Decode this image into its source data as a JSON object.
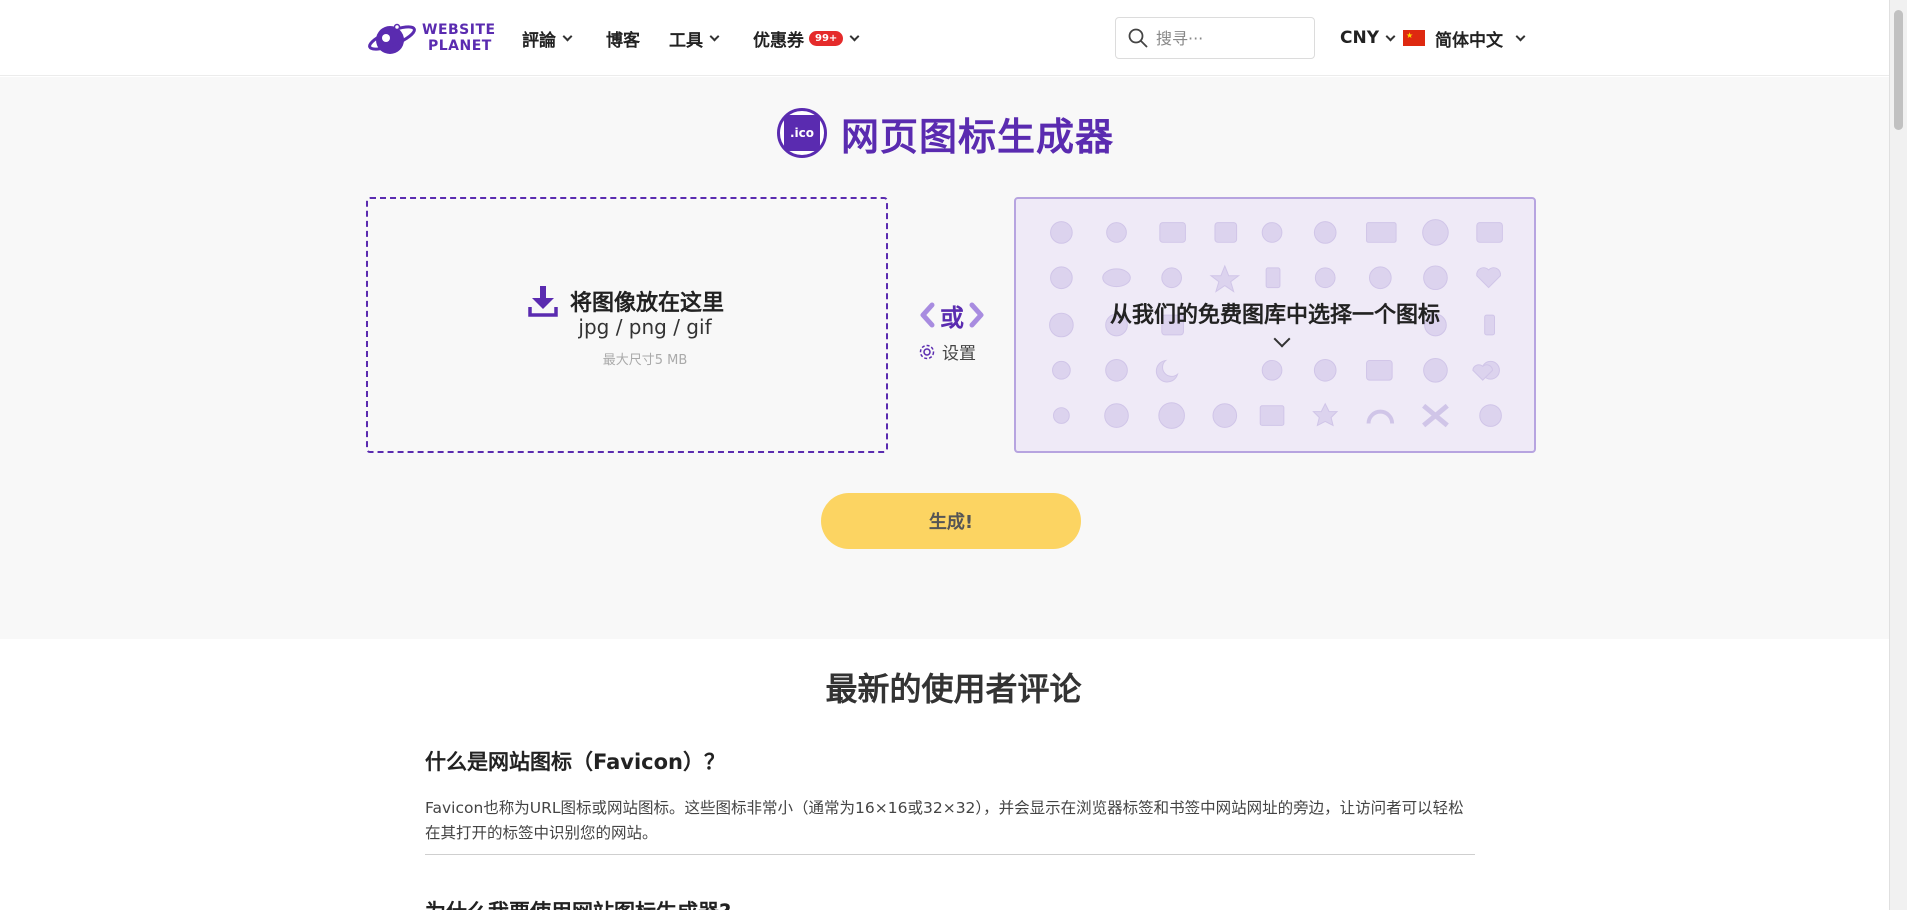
{
  "header": {
    "logo_line1": "WEBSITE",
    "logo_line2": "PLANET",
    "nav": [
      {
        "label": "評論",
        "has_dropdown": true
      },
      {
        "label": "博客",
        "has_dropdown": false
      },
      {
        "label": "工具",
        "has_dropdown": true
      },
      {
        "label": "优惠券",
        "badge": "99+",
        "has_dropdown": true
      }
    ],
    "search_placeholder": "搜寻···",
    "currency": "CNY",
    "language": "简体中文"
  },
  "hero": {
    "ico_label": ".ico",
    "title": "网页图标生成器",
    "dropzone": {
      "title": "将图像放在这里",
      "formats": "jpg / png / gif",
      "max_size": "最大尺寸5 MB"
    },
    "or_label": "或",
    "settings_label": "设置",
    "library_label": "从我们的免费图库中选择一个图标",
    "generate_label": "生成!"
  },
  "content": {
    "section_title": "最新的使用者评论",
    "faq": [
      {
        "question": "什么是网站图标（Favicon）？",
        "answer": "Favicon也称为URL图标或网站图标。这些图标非常小（通常为16×16或32×32），并会显示在浏览器标签和书签中网站网址的旁边，让访问者可以轻松在其打开的标签中识别您的网站。"
      },
      {
        "question": "为什么我要使用网站图标生成器?"
      }
    ]
  },
  "colors": {
    "brand": "#5a2bb0",
    "generate_button": "#fcd462",
    "badge": "#e52b2b"
  },
  "icons": [
    "search-icon",
    "download-icon",
    "gear-icon",
    "chevron-down-icon",
    "chevron-left-icon",
    "chevron-right-icon",
    "china-flag-icon"
  ]
}
